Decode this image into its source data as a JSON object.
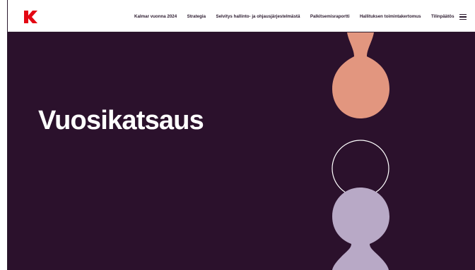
{
  "header": {
    "logo_icon": "kalmar-k-logo-icon",
    "brand_color": "#e30613",
    "nav": [
      {
        "label": "Kalmar vuonna 2024"
      },
      {
        "label": "Strategia"
      },
      {
        "label": "Selvitys hallinto- ja ohjausjärjestelmästä"
      },
      {
        "label": "Palkitsemisraportti"
      },
      {
        "label": "Hallituksen toimintakertomus"
      },
      {
        "label": "Tilinpäätös"
      }
    ],
    "menu_icon": "hamburger-menu-icon"
  },
  "hero": {
    "title": "Vuosikatsaus",
    "background": "#2b112c",
    "shape_colors": {
      "salmon": "#e2967f",
      "lilac": "#b8a9c6",
      "outline": "#ffffff"
    }
  }
}
